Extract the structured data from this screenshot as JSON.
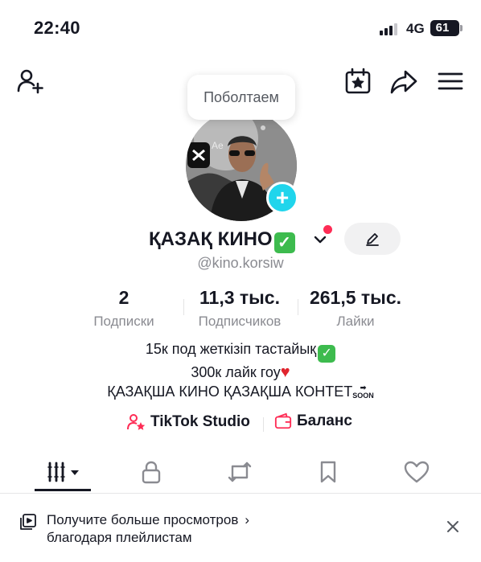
{
  "status_bar": {
    "time": "22:40",
    "network": "4G",
    "battery": "61",
    "battery_level": 0.61
  },
  "top_bar": {
    "icons": [
      "add-user-icon",
      "calendar-star-icon",
      "share-icon",
      "menu-icon"
    ]
  },
  "tooltip": {
    "text": "Поболтаем"
  },
  "profile": {
    "name": "ҚАЗАҚ КИНО",
    "verified_emoji": "✅",
    "handle": "@kino.korsiw",
    "accent_color": "#20d5ec",
    "notification_color": "#fe2c55"
  },
  "stats": [
    {
      "value": "2",
      "label": "Подписки"
    },
    {
      "value": "11,3 тыс.",
      "label": "Подписчиков"
    },
    {
      "value": "261,5 тыс.",
      "label": "Лайки"
    }
  ],
  "bio": {
    "line1": "15к под жеткізіп тастайық",
    "line1_emoji": "✅",
    "line2": "300к лайк гоу",
    "line2_emoji": "❤️",
    "line3": "ҚАЗАҚША КИНО ҚАЗАҚША КОНТЕТ",
    "line3_badge": "SOON"
  },
  "links": {
    "studio": "TikTok Studio",
    "balance": "Баланс"
  },
  "tabs": [
    "videos-grid-icon",
    "lock-icon",
    "repost-icon",
    "bookmark-icon",
    "heart-icon"
  ],
  "banner": {
    "line1": "Получите больше просмотров",
    "line2": "благодаря плейлистам",
    "chevron": "›"
  }
}
